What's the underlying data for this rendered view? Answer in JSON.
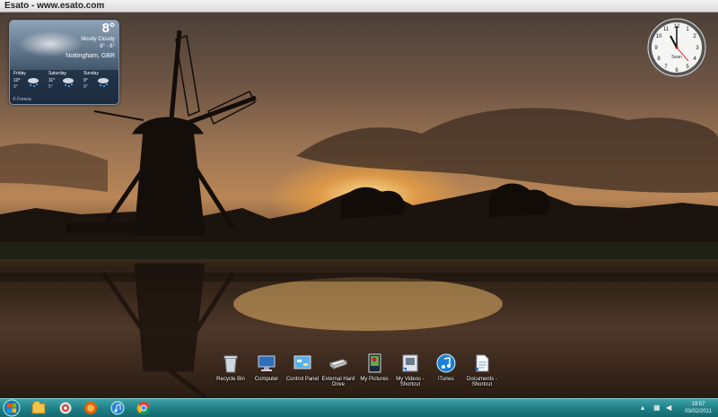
{
  "watermark": "Esato - www.esato.com",
  "weather": {
    "temperature": "8°",
    "condition": "Mostly Cloudy",
    "range": "8° - 6°",
    "location": "Nottingham, GBR",
    "forecast": [
      {
        "day": "Friday",
        "high": "10°",
        "low": "9°"
      },
      {
        "day": "Saturday",
        "high": "11°",
        "low": "5°"
      },
      {
        "day": "Sunday",
        "high": "9°",
        "low": "8°"
      }
    ],
    "provider": "© Foreca"
  },
  "clock": {
    "label": "Sean"
  },
  "desktop_icons": [
    {
      "label": "Recycle Bin",
      "icon": "recycle-bin-icon"
    },
    {
      "label": "Computer",
      "icon": "computer-icon"
    },
    {
      "label": "Control Panel",
      "icon": "control-panel-icon"
    },
    {
      "label": "External Hard Drive",
      "icon": "hard-drive-icon"
    },
    {
      "label": "My Pictures",
      "icon": "pictures-icon"
    },
    {
      "label": "My Videos - Shortcut",
      "icon": "videos-icon"
    },
    {
      "label": "iTunes",
      "icon": "itunes-icon"
    },
    {
      "label": "Documents - Shortcut",
      "icon": "documents-icon"
    }
  ],
  "taskbar": {
    "pinned": [
      "windows-explorer-icon",
      "paint-icon",
      "firefox-icon",
      "app-icon",
      "itunes-icon",
      "chrome-icon"
    ],
    "time": "19:57",
    "date": "03/02/2011"
  },
  "colors": {
    "taskbar": "#1d7d84",
    "watermark_bg": "#e8e8e8"
  }
}
